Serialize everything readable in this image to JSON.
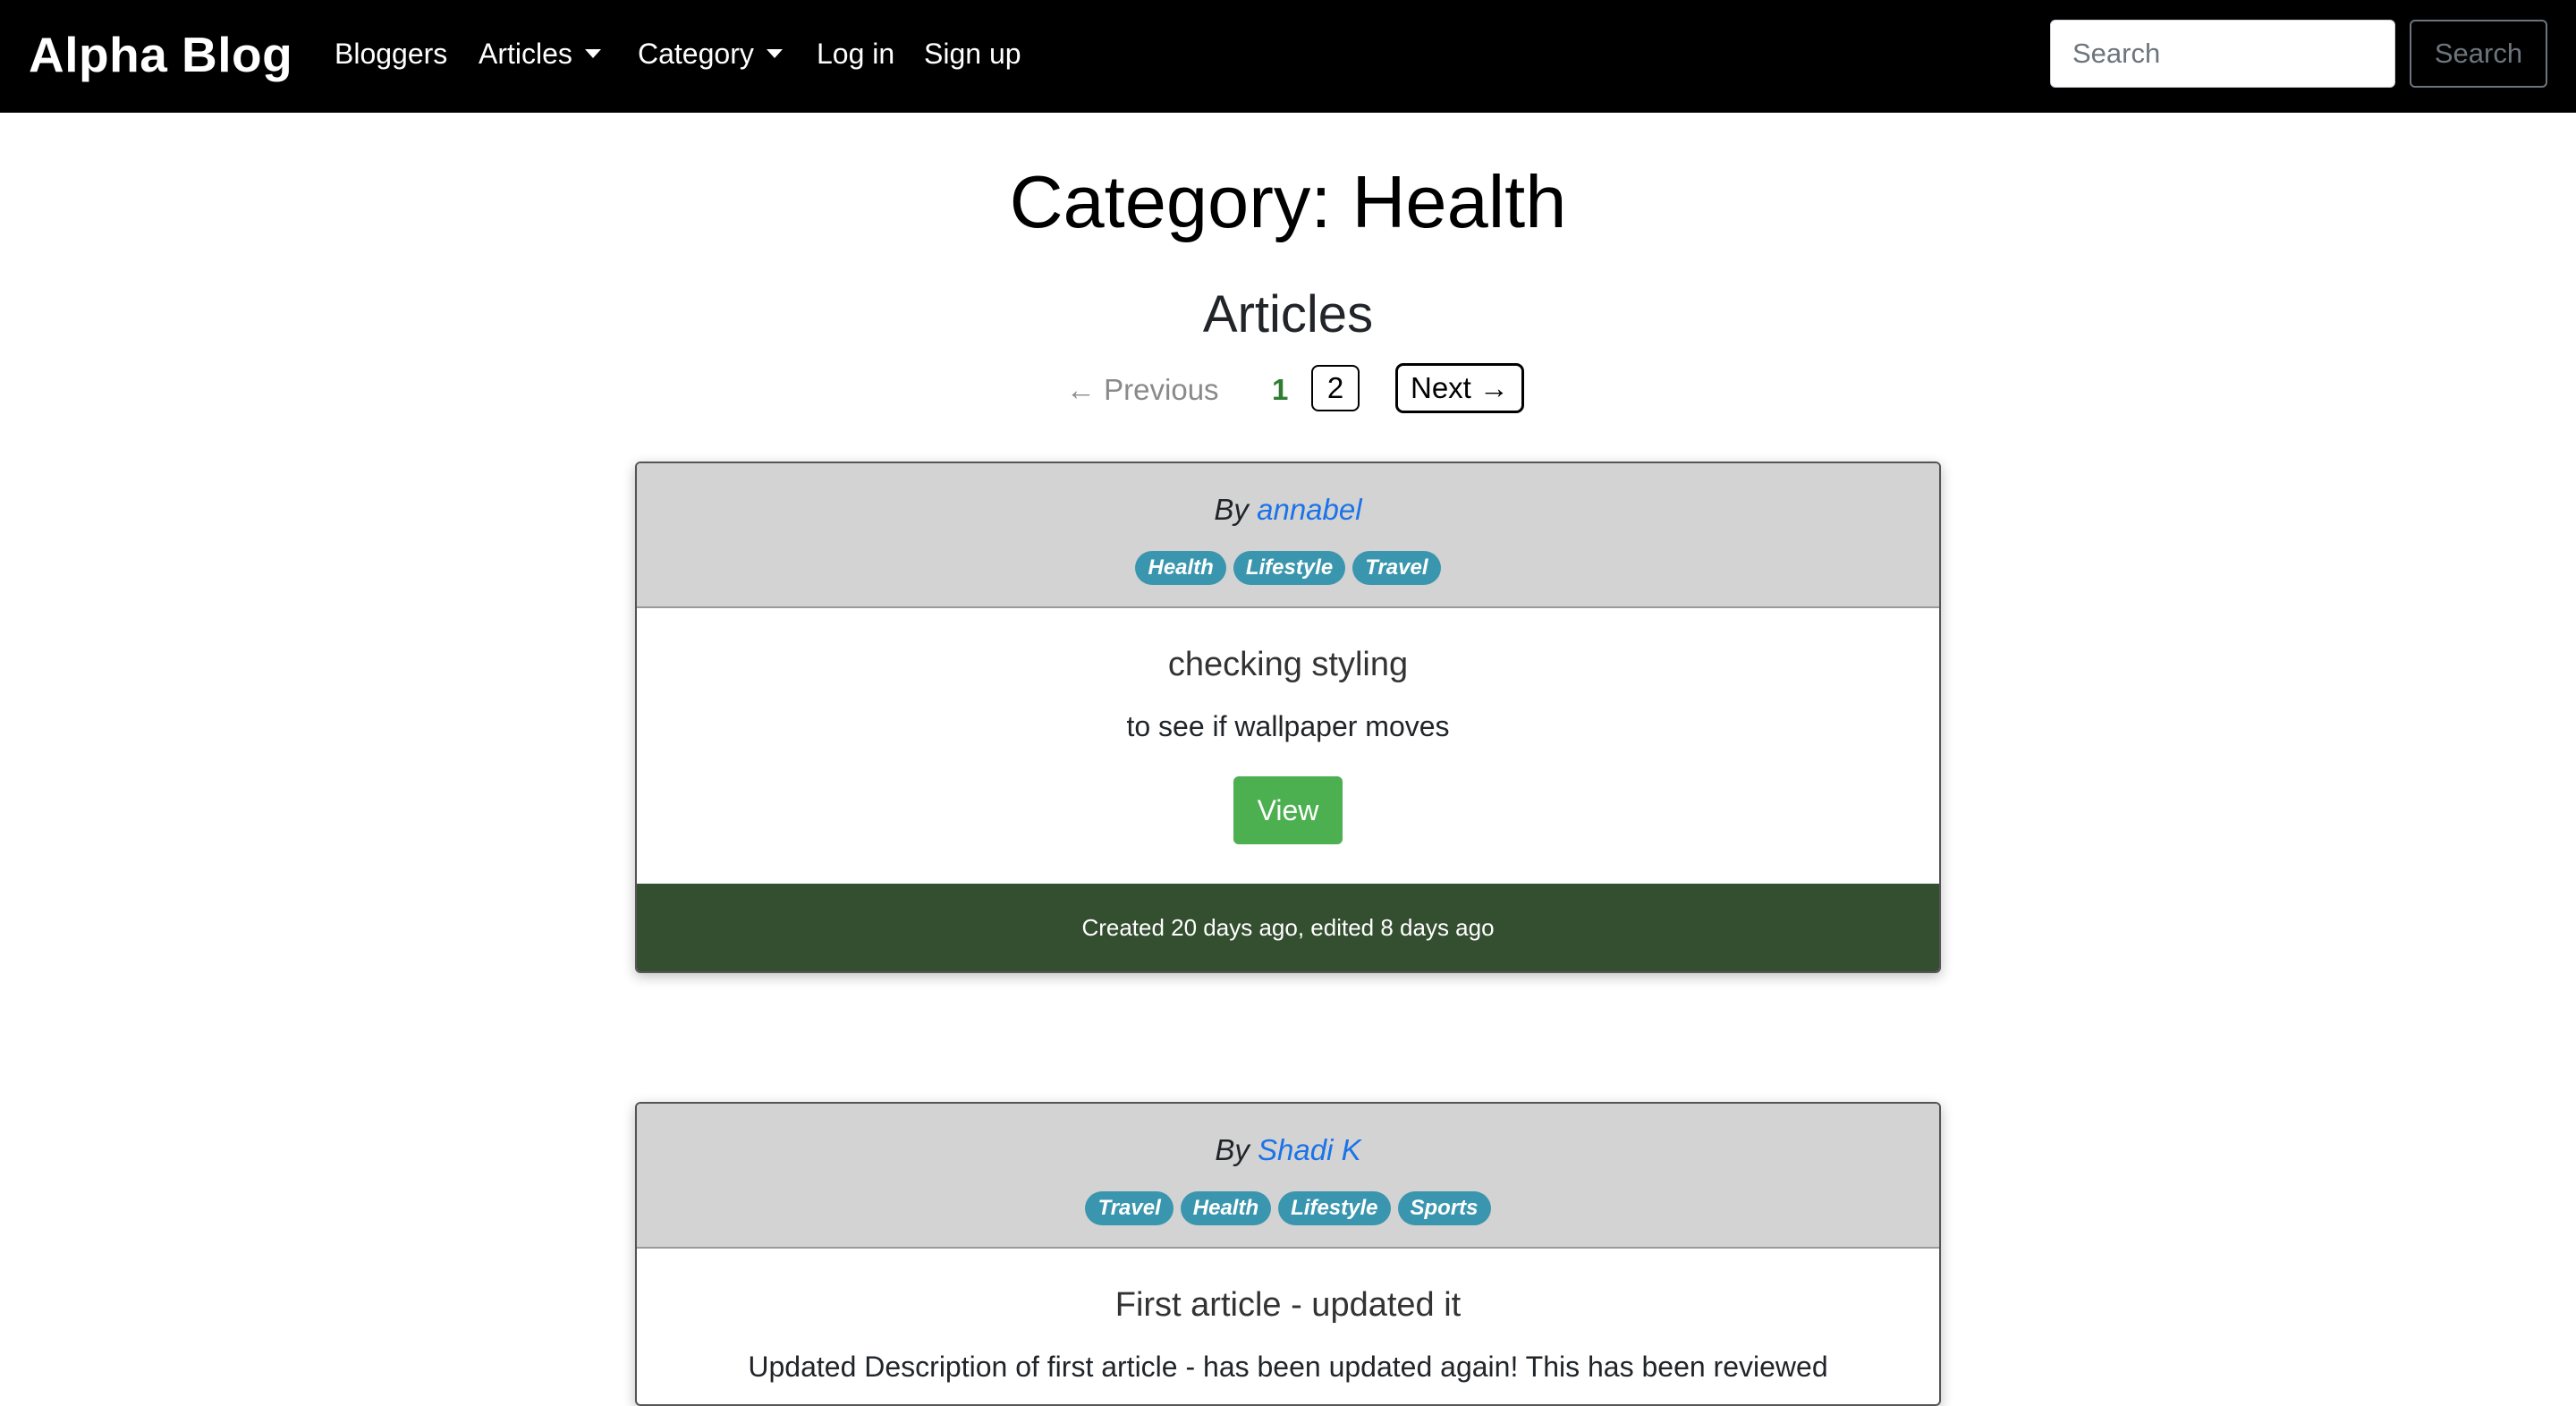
{
  "navbar": {
    "brand": "Alpha Blog",
    "links": {
      "bloggers": "Bloggers",
      "articles": "Articles",
      "category": "Category",
      "login": "Log in",
      "signup": "Sign up"
    },
    "search_placeholder": "Search",
    "search_button": "Search"
  },
  "page": {
    "title": "Category: Health",
    "section": "Articles"
  },
  "pagination": {
    "previous": "← Previous",
    "current_page": "1",
    "page_2": "2",
    "next": "Next →"
  },
  "articles": [
    {
      "by_prefix": "By ",
      "author": "annabel",
      "tags": [
        "Health",
        "Lifestyle",
        "Travel"
      ],
      "title": "checking styling",
      "description": "to see if wallpaper moves",
      "view_label": "View",
      "footer": "Created 20 days ago, edited 8 days ago"
    },
    {
      "by_prefix": "By ",
      "author": "Shadi K",
      "tags": [
        "Travel",
        "Health",
        "Lifestyle",
        "Sports"
      ],
      "title": "First article - updated it",
      "description": "Updated Description of first article - has been updated again! This has been reviewed"
    }
  ],
  "colors": {
    "navbar_bg": "#000000",
    "badge": "#3a96ae",
    "view_button": "#4caf50",
    "card_footer": "#344e30",
    "current_page": "#2e7d32",
    "author_link": "#1a73e8"
  }
}
